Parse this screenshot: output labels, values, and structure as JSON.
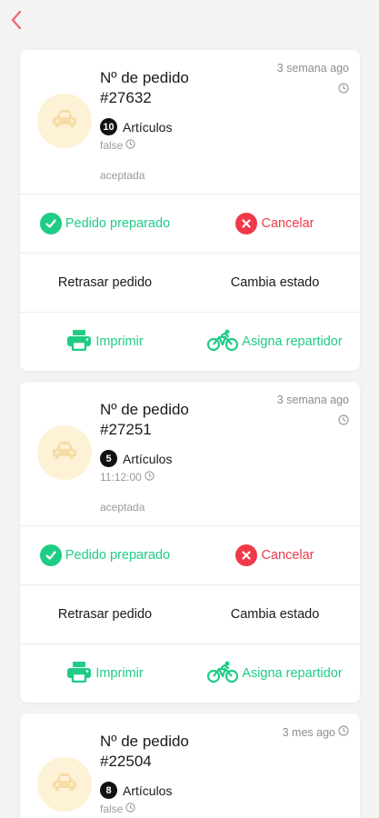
{
  "nav": {
    "back_icon": "chevron-left-icon",
    "accent": "#f06a75"
  },
  "colors": {
    "green": "#1fcc86",
    "red": "#f03a4a",
    "avatar_bg": "#fdf1d6",
    "avatar_icon": "#f6dda6"
  },
  "orders": [
    {
      "title": "Nº de pedido",
      "number": "#27632",
      "ago": "3 semana ago",
      "items_count": "10",
      "items_label": "Artículos",
      "time": "false",
      "status": "aceptada",
      "actions": {
        "prepared": "Pedido preparado",
        "cancel": "Cancelar",
        "delay": "Retrasar pedido",
        "change_state": "Cambia estado",
        "print": "Imprimir",
        "assign": "Asigna repartidor"
      }
    },
    {
      "title": "Nº de pedido",
      "number": "#27251",
      "ago": "3 semana ago",
      "items_count": "5",
      "items_label": "Artículos",
      "time": "11:12:00",
      "status": "aceptada",
      "actions": {
        "prepared": "Pedido preparado",
        "cancel": "Cancelar",
        "delay": "Retrasar pedido",
        "change_state": "Cambia estado",
        "print": "Imprimir",
        "assign": "Asigna repartidor"
      }
    },
    {
      "title": "Nº de pedido",
      "number": "#22504",
      "ago": "3 mes ago",
      "items_count": "8",
      "items_label": "Artículos",
      "time": "false"
    }
  ]
}
